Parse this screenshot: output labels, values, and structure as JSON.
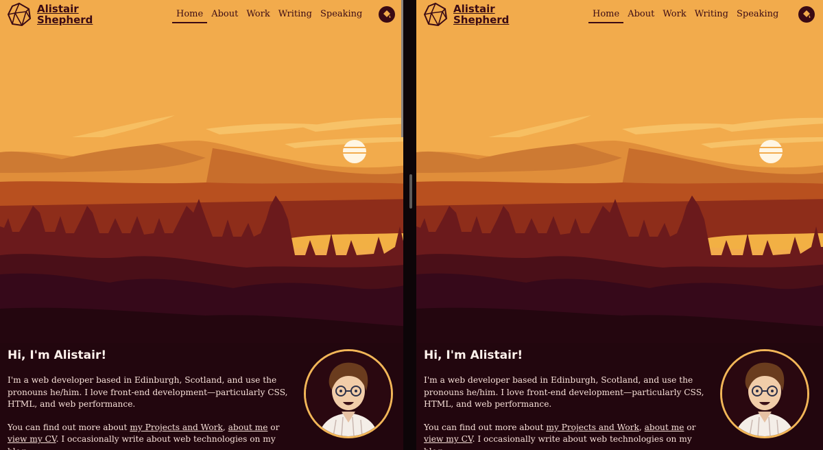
{
  "site": {
    "name_line1": "Alistair",
    "name_line2": "Shepherd",
    "nav": [
      "Home",
      "About",
      "Work",
      "Writing",
      "Speaking"
    ],
    "active_nav": "Home",
    "theme_icon": "paint-bucket-icon",
    "logo_icon": "polyhedron-icon"
  },
  "intro": {
    "heading": "Hi, I'm Alistair!",
    "para1": "I'm a web developer based in Edinburgh, Scotland, and use the pronouns he/him. I love front-end development—particularly CSS, HTML, and web performance.",
    "para2_prefix": "You can find out more about ",
    "link_projects": "my Projects and Work",
    "para2_comma": ", ",
    "link_about": "about me",
    "para2_or": " or ",
    "link_cv": "view my CV",
    "para2_mid": ". I occasionally write about web technologies on my ",
    "link_blog": "blog",
    "para2_end": "."
  },
  "colors": {
    "sky": "#f2ab4c",
    "ink": "#3a0a14",
    "avatar_ring": "#f2b658"
  }
}
